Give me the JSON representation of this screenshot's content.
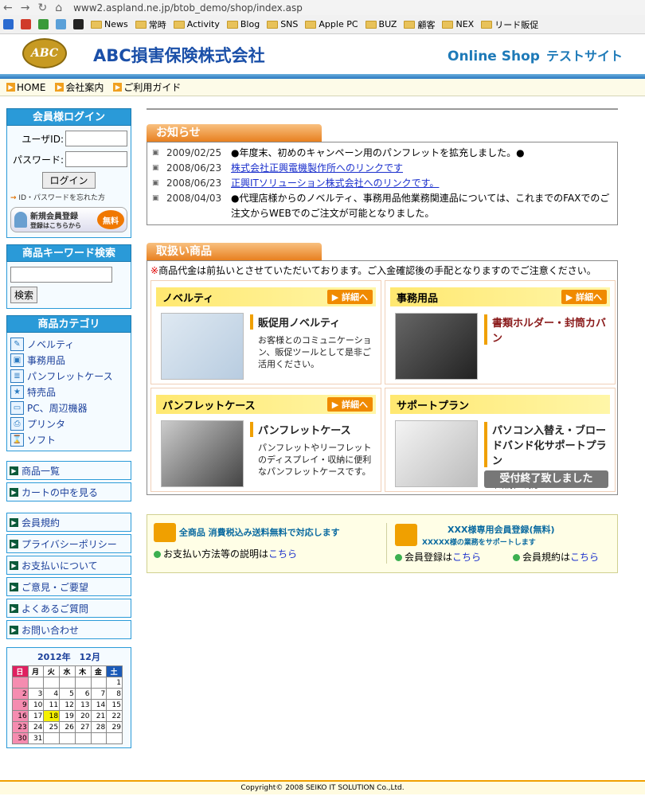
{
  "browser": {
    "url": "www2.aspland.ne.jp/btob_demo/shop/index.asp"
  },
  "bookmarks": [
    "News",
    "常時",
    "Activity",
    "Blog",
    "SNS",
    "Apple PC",
    "BUZ",
    "顧客",
    "NEX",
    "リード販促"
  ],
  "header": {
    "logo": "ABC",
    "company": "ABC損害保険株式会社",
    "online": "Online Shop",
    "test": "テストサイト"
  },
  "subnav": [
    "HOME",
    "会社案内",
    "ご利用ガイド"
  ],
  "login": {
    "title": "会員様ログイン",
    "user_label": "ユーザID:",
    "pass_label": "パスワード:",
    "button": "ログイン",
    "forgot": "ID・パスワードを忘れた方",
    "newreg": "新規会員登録",
    "newreg_sub": "登録はこちらから",
    "free": "無料"
  },
  "search": {
    "title": "商品キーワード検索",
    "button": "検索"
  },
  "categories": {
    "title": "商品カテゴリ",
    "items": [
      "ノベルティ",
      "事務用品",
      "パンフレットケース",
      "特売品",
      "PC、周辺機器",
      "プリンタ",
      "ソフト"
    ]
  },
  "links1": [
    "商品一覧",
    "カートの中を見る"
  ],
  "links2": [
    "会員規約",
    "プライバシーポリシー",
    "お支払いについて",
    "ご意見・ご要望",
    "よくあるご質問",
    "お問い合わせ"
  ],
  "calendar": {
    "title": "2012年　12月",
    "days": [
      "日",
      "月",
      "火",
      "水",
      "木",
      "金",
      "土"
    ],
    "weeks": [
      [
        "",
        "",
        "",
        "",
        "",
        "",
        "1"
      ],
      [
        "2",
        "3",
        "4",
        "5",
        "6",
        "7",
        "8"
      ],
      [
        "9",
        "10",
        "11",
        "12",
        "13",
        "14",
        "15"
      ],
      [
        "16",
        "17",
        "18",
        "19",
        "20",
        "21",
        "22"
      ],
      [
        "23",
        "24",
        "25",
        "26",
        "27",
        "28",
        "29"
      ],
      [
        "30",
        "31",
        "",
        "",
        "",
        "",
        ""
      ]
    ]
  },
  "news": {
    "title": "お知らせ",
    "items": [
      {
        "date": "2009/02/25",
        "text": "●年度末、初めのキャンペーン用のパンフレットを拡充しました。●",
        "link": false
      },
      {
        "date": "2008/06/23",
        "text": "株式会社正興電機製作所へのリンクです",
        "link": true
      },
      {
        "date": "2008/06/23",
        "text": "正興ITソリューション株式会社へのリンクです。",
        "link": true
      },
      {
        "date": "2008/04/03",
        "text": "●代理店様からのノベルティ、事務用品他業務関連品については、これまでのFAXでのご注文からWEBでのご注文が可能となりました。",
        "link": false
      }
    ]
  },
  "products": {
    "title": "取扱い商品",
    "note_mark": "※",
    "note": "商品代金は前払いとさせていただいております。ご入金確認後の手配となりますのでご注意ください。",
    "detail": "詳細へ",
    "cards": [
      {
        "name": "ノベルティ",
        "title": "販促用ノベルティ",
        "desc": "お客様とのコミュニケーション、販促ツールとして是非ご活用ください。"
      },
      {
        "name": "事務用品",
        "title": "書類ホルダー・封筒カバン",
        "desc": ""
      },
      {
        "name": "パンフレットケース",
        "title": "パンフレットケース",
        "desc": "パンフレットやリーフレットのディスプレイ・収納に便利なパンフレットケースです。"
      },
      {
        "name": "サポートプラン",
        "title": "パソコン入替え・ブロードバンド化サポートプラン",
        "desc": "<リース満了>・<次期システム(抜本改訂)> 対応",
        "ended": "受付終了致しました"
      }
    ]
  },
  "guide": {
    "left_title": "全商品 消費税込み送料無料で対応します",
    "left_link_pre": "お支払い方法等の説明は",
    "here": "こちら",
    "right_title": "XXX様専用会員登録(無料)",
    "right_sub": "XXXXX様の業務をサポートします",
    "reg_pre": "会員登録は",
    "terms_pre": "会員規約は"
  },
  "footer": "Copyright© 2008 SEIKO IT SOLUTION Co.,Ltd."
}
